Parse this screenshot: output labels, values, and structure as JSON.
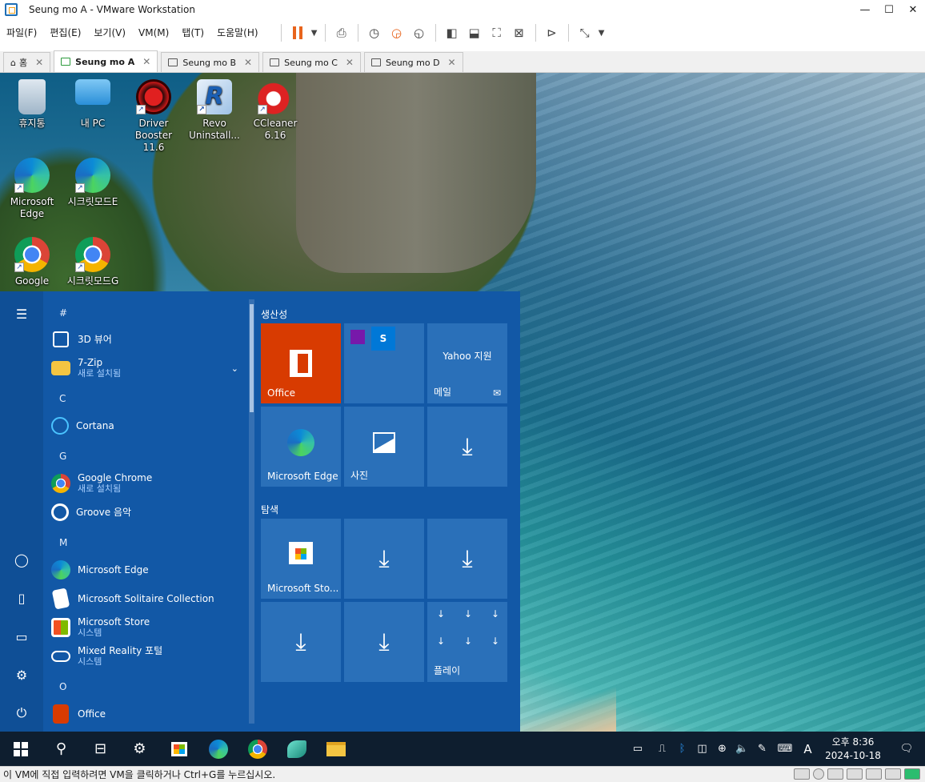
{
  "window": {
    "title": "Seung mo A - VMware Workstation",
    "minimize": "—",
    "maximize": "☐",
    "close": "✕"
  },
  "menu": [
    "파일(F)",
    "편집(E)",
    "보기(V)",
    "VM(M)",
    "탭(T)",
    "도움말(H)"
  ],
  "tabs": [
    {
      "label": "홈"
    },
    {
      "label": "Seung mo A"
    },
    {
      "label": "Seung mo B"
    },
    {
      "label": "Seung mo C"
    },
    {
      "label": "Seung mo D"
    }
  ],
  "desktop_icons": [
    {
      "label": "휴지통"
    },
    {
      "label": "내 PC"
    },
    {
      "label": "Driver Booster 11.6"
    },
    {
      "label": "Revo Uninstall..."
    },
    {
      "label": "CCleaner 6.16"
    },
    {
      "label": "Microsoft Edge"
    },
    {
      "label": "시크릿모드E"
    },
    {
      "label": "Google"
    },
    {
      "label": "시크릿모드G"
    }
  ],
  "start_menu": {
    "apps": [
      {
        "header": "#"
      },
      {
        "name": "3D 뷰어"
      },
      {
        "name": "7-Zip",
        "sub": "새로 설치됨"
      },
      {
        "header": "C"
      },
      {
        "name": "Cortana"
      },
      {
        "header": "G"
      },
      {
        "name": "Google Chrome",
        "sub": "새로 설치됨"
      },
      {
        "name": "Groove 음악"
      },
      {
        "header": "M"
      },
      {
        "name": "Microsoft Edge"
      },
      {
        "name": "Microsoft Solitaire Collection"
      },
      {
        "name": "Microsoft Store",
        "sub": "시스템"
      },
      {
        "name": "Mixed Reality 포털",
        "sub": "시스템"
      },
      {
        "header": "O"
      },
      {
        "name": "Office"
      }
    ],
    "groups": [
      "생산성",
      "탐색"
    ],
    "tiles": {
      "office": "Office",
      "yahoo": "Yahoo 지원",
      "mail": "메일",
      "edge": "Microsoft Edge",
      "photos": "사진",
      "store": "Microsoft Sto...",
      "play": "플레이"
    }
  },
  "taskbar": {
    "clock_time": "오후 8:36",
    "clock_date": "2024-10-18",
    "ime": "A"
  },
  "statusbar": {
    "text": "이 VM에 직접 입력하려면 VM을 클릭하거나 Ctrl+G를 누르십시오."
  },
  "colors": {
    "start_bg": "#1258a6",
    "tile_bg": "#2a70b9",
    "office_tile": "#d83b01",
    "taskbar": "#0e1e2f"
  }
}
